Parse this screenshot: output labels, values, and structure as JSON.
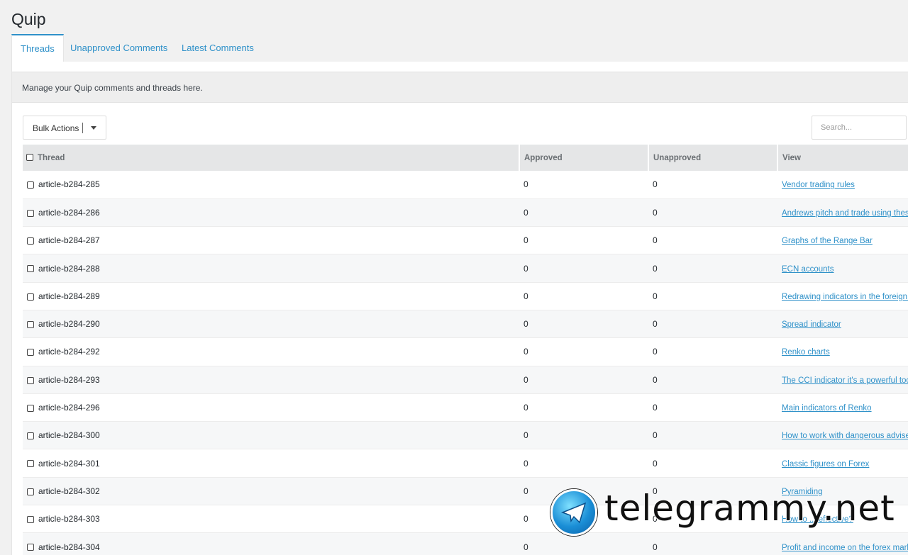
{
  "page": {
    "title": "Quip"
  },
  "tabs": [
    {
      "label": "Threads",
      "active": true
    },
    {
      "label": "Unapproved Comments",
      "active": false
    },
    {
      "label": "Latest Comments",
      "active": false
    }
  ],
  "notice": "Manage your Quip comments and threads here.",
  "toolbar": {
    "bulk_actions_label": "Bulk Actions",
    "search_placeholder": "Search..."
  },
  "table": {
    "columns": [
      "Thread",
      "Approved",
      "Unapproved",
      "View"
    ],
    "rows": [
      {
        "thread": "article-b284-285",
        "approved": "0",
        "unapproved": "0",
        "view": "Vendor trading rules"
      },
      {
        "thread": "article-b284-286",
        "approved": "0",
        "unapproved": "0",
        "view": "Andrews pitch and trade using these"
      },
      {
        "thread": "article-b284-287",
        "approved": "0",
        "unapproved": "0",
        "view": "Graphs of the Range Bar"
      },
      {
        "thread": "article-b284-288",
        "approved": "0",
        "unapproved": "0",
        "view": "ECN accounts"
      },
      {
        "thread": "article-b284-289",
        "approved": "0",
        "unapproved": "0",
        "view": "Redrawing indicators in the foreign e"
      },
      {
        "thread": "article-b284-290",
        "approved": "0",
        "unapproved": "0",
        "view": "Spread indicator"
      },
      {
        "thread": "article-b284-292",
        "approved": "0",
        "unapproved": "0",
        "view": "Renko charts"
      },
      {
        "thread": "article-b284-293",
        "approved": "0",
        "unapproved": "0",
        "view": "The CCI indicator it's a powerful tool"
      },
      {
        "thread": "article-b284-296",
        "approved": "0",
        "unapproved": "0",
        "view": "Main indicators of Renko"
      },
      {
        "thread": "article-b284-300",
        "approved": "0",
        "unapproved": "0",
        "view": "How to work with dangerous adviser"
      },
      {
        "thread": "article-b284-301",
        "approved": "0",
        "unapproved": "0",
        "view": "Classic figures on Forex"
      },
      {
        "thread": "article-b284-302",
        "approved": "0",
        "unapproved": "0",
        "view": "Pyramiding"
      },
      {
        "thread": "article-b284-303",
        "approved": "0",
        "unapproved": "0",
        "view": "How to ... effective?"
      },
      {
        "thread": "article-b284-304",
        "approved": "0",
        "unapproved": "0",
        "view": "Profit and income on the forex marke"
      }
    ]
  },
  "watermark": {
    "text": "telegrammy.net",
    "icon": "telegram-icon"
  },
  "colors": {
    "accent": "#2f91c9",
    "header_bg": "#e5e6e7",
    "page_bg": "#f1f1f1"
  }
}
